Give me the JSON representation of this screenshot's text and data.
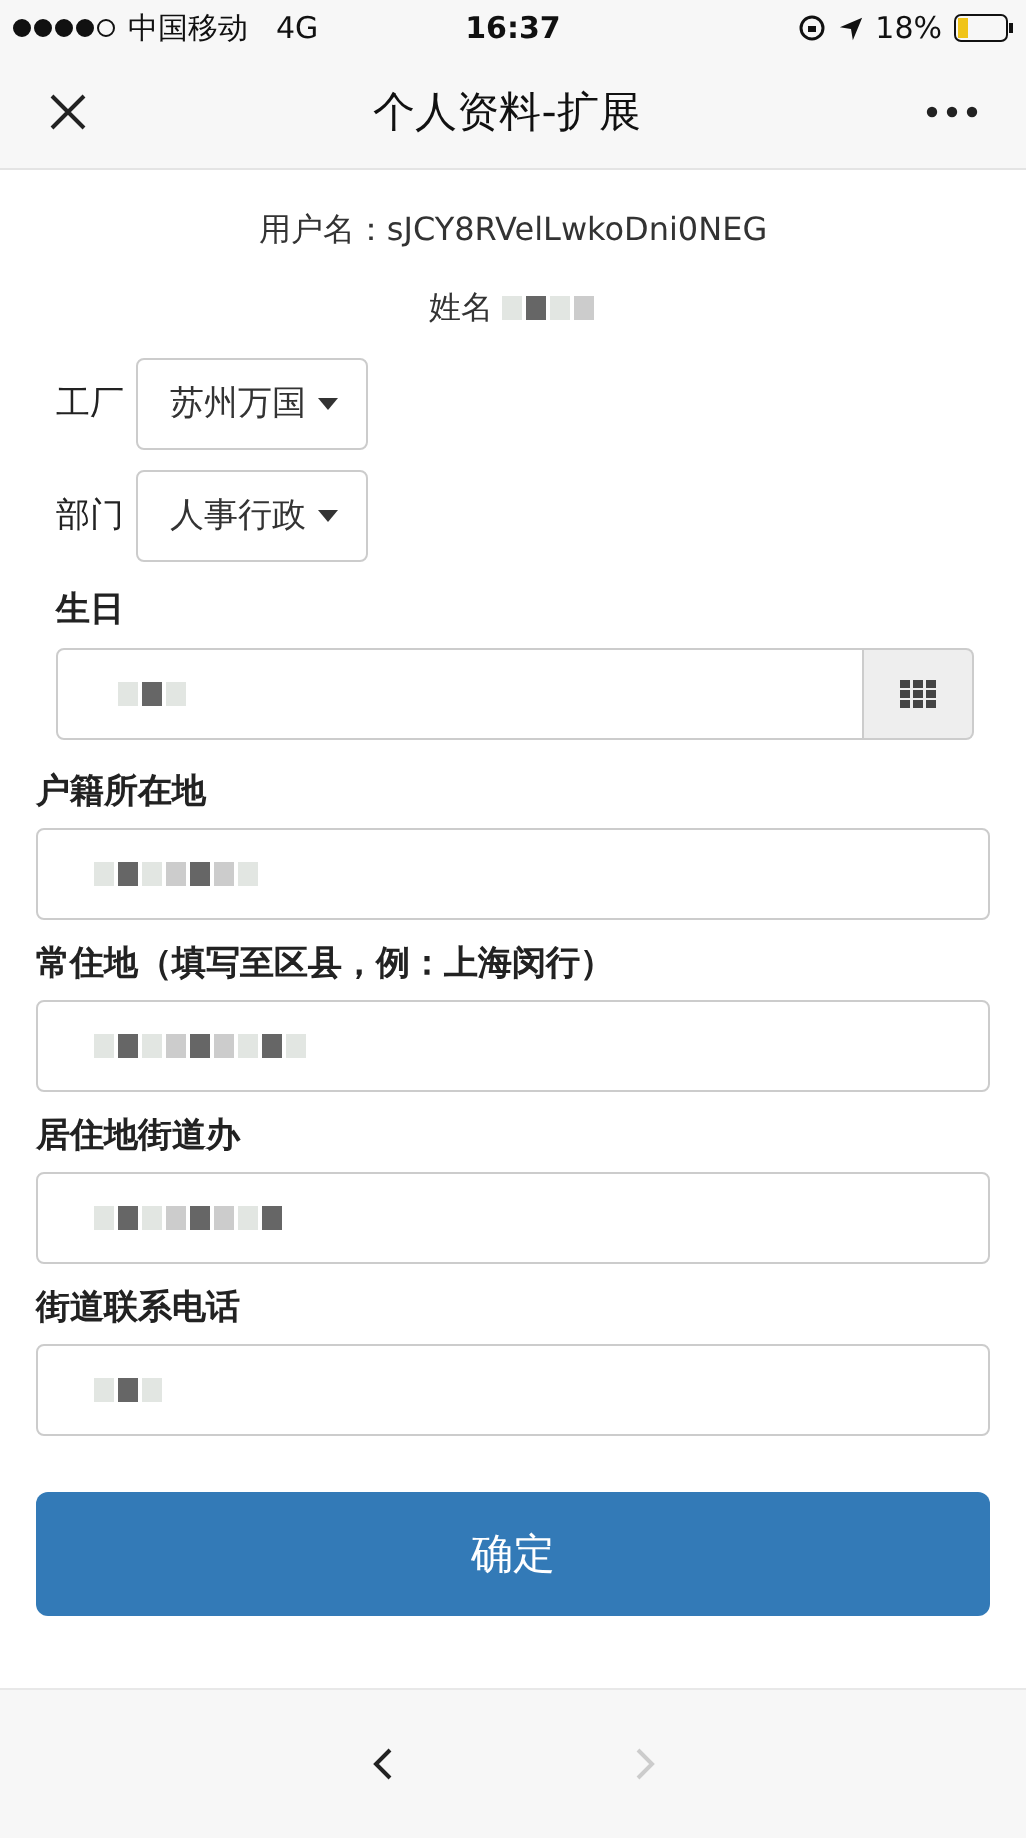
{
  "status_bar": {
    "carrier": "中国移动",
    "network": "4G",
    "time": "16:37",
    "battery": "18%"
  },
  "nav_bar": {
    "title": "个人资料-扩展"
  },
  "user": {
    "username": "用户名：sJCY8RVelLwkoDni0NEG",
    "name_label": "姓名"
  },
  "selects": [
    {
      "label": "工厂",
      "value": "苏州万国"
    },
    {
      "label": "部门",
      "value": "人事行政"
    }
  ],
  "birthday": {
    "label": "生日"
  },
  "fields": [
    {
      "label": "户籍所在地"
    },
    {
      "label": "常住地（填写至区县，例：上海闵行）"
    },
    {
      "label": "居住地街道办"
    },
    {
      "label": "街道联系电话"
    }
  ],
  "submit": "确定",
  "toolbar": [
    {
      "kind": "back",
      "disabled": false
    },
    {
      "kind": "forward",
      "disabled": true
    }
  ]
}
